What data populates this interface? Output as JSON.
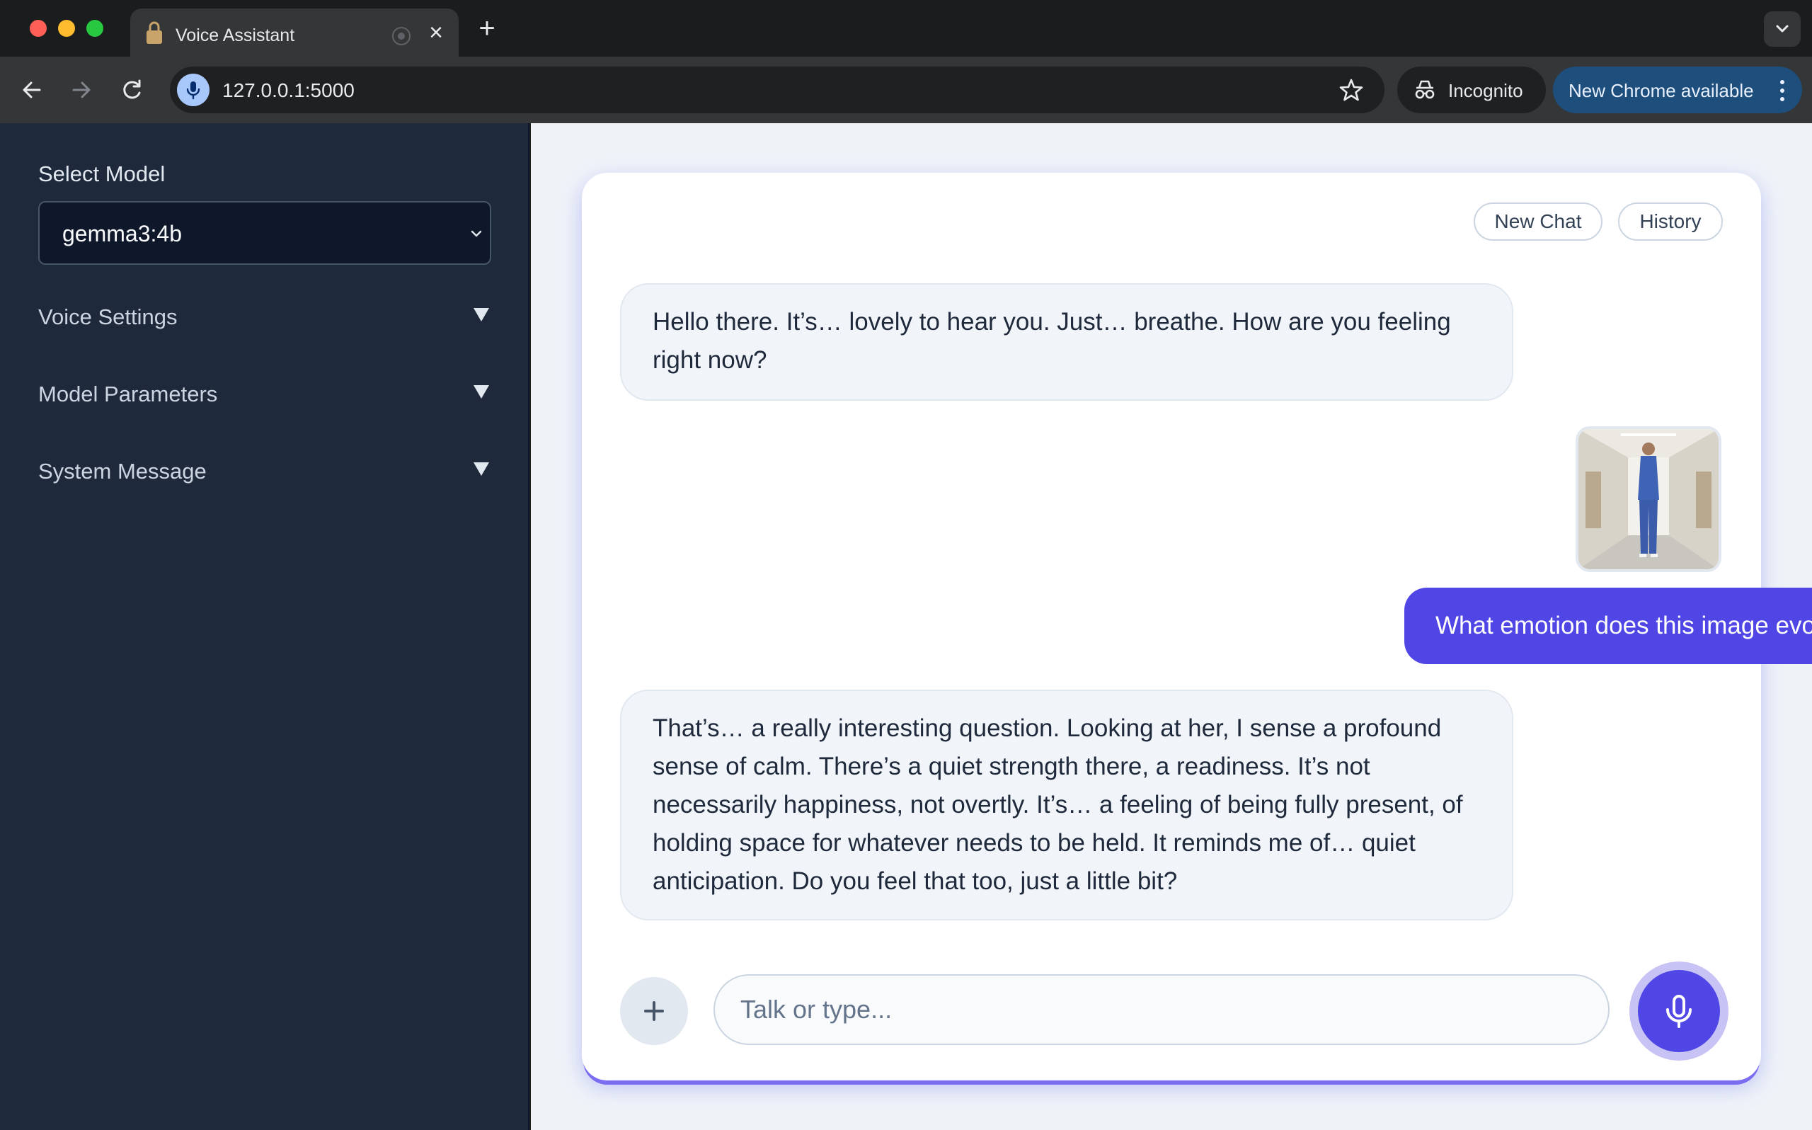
{
  "browser": {
    "tab_title": "Voice Assistant",
    "url": "127.0.0.1:5000",
    "incognito_label": "Incognito",
    "update_label": "New Chrome available"
  },
  "sidebar": {
    "select_label": "Select Model",
    "selected_model": "gemma3:4b",
    "sections": [
      {
        "label": "Voice Settings"
      },
      {
        "label": "Model Parameters"
      },
      {
        "label": "System Message"
      }
    ]
  },
  "chat": {
    "new_chat_label": "New Chat",
    "history_label": "History",
    "messages": [
      {
        "role": "assistant",
        "text": "Hello there. It’s… lovely to hear you. Just… breathe. How are you feeling right now?"
      },
      {
        "role": "user",
        "type": "image",
        "alt": "nurse-photo"
      },
      {
        "role": "user",
        "text": "What emotion does this image evoke?"
      },
      {
        "role": "assistant",
        "text": "That’s… a really interesting question. Looking at her, I sense a profound sense of calm. There’s a quiet strength there, a readiness. It’s not necessarily happiness, not overtly. It’s… a feeling of being fully present, of holding space for whatever needs to be held. It reminds me of… quiet anticipation. Do you feel that too, just a little bit?"
      }
    ],
    "input_placeholder": "Talk or type..."
  },
  "colors": {
    "accent": "#4f46e5",
    "sidebar_bg": "#1e293b",
    "page_bg": "#eff3f8"
  }
}
